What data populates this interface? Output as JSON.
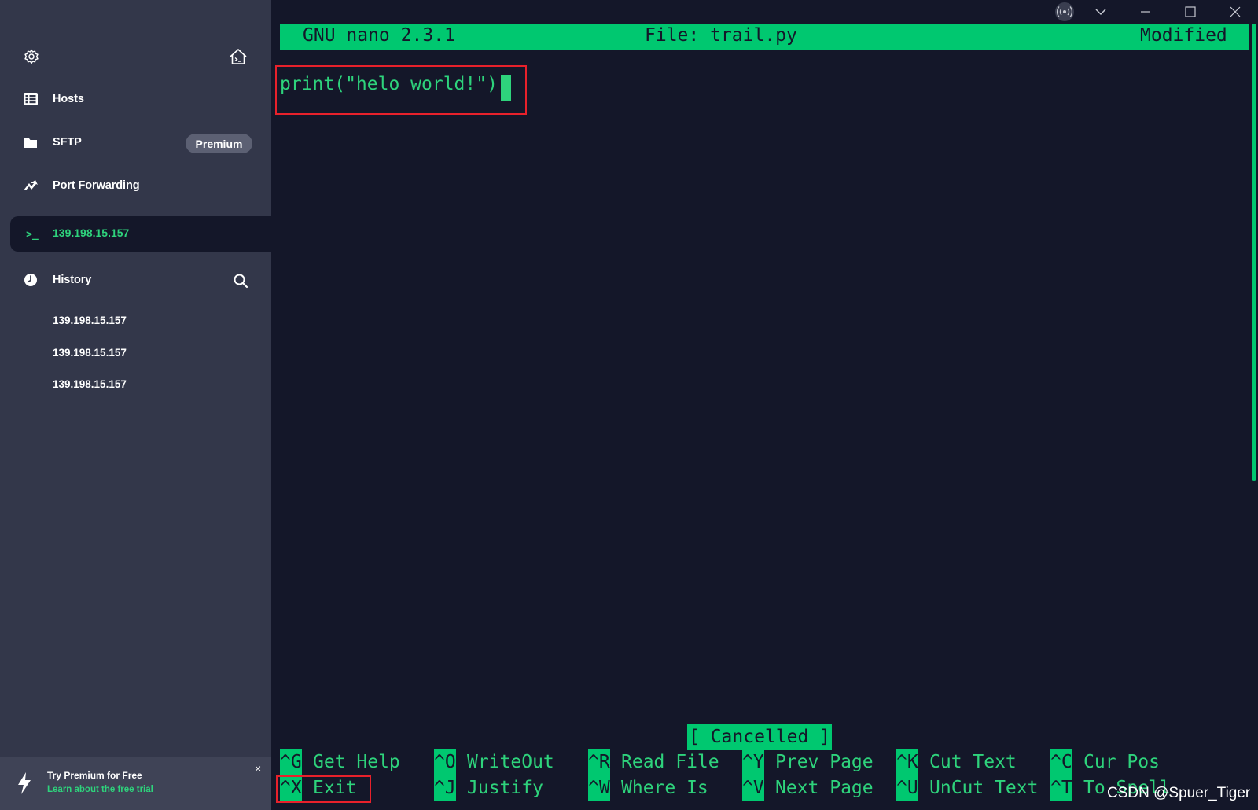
{
  "colors": {
    "sidebar_bg": "#33374a",
    "terminal_bg": "#141729",
    "accent_green": "#2ed37c",
    "highlight_green": "#00c870",
    "badge_bg": "#5c6073",
    "annotation_red": "#e8212b"
  },
  "sidebar": {
    "top_icons": [
      "gear-icon",
      "home-terminal-icon"
    ],
    "nav": [
      {
        "label": "Hosts",
        "icon": "hosts-grid-icon"
      },
      {
        "label": "SFTP",
        "icon": "folder-icon",
        "badge": "Premium"
      },
      {
        "label": "Port Forwarding",
        "icon": "port-forward-icon"
      }
    ],
    "active_session": {
      "label": "139.198.15.157",
      "icon": "terminal-prompt-icon",
      "icon_text": ">_"
    },
    "history": {
      "label": "History",
      "icon": "clock-icon",
      "search_icon": "search-icon",
      "items": [
        "139.198.15.157",
        "139.198.15.157",
        "139.198.15.157"
      ]
    },
    "promo": {
      "title": "Try Premium for Free",
      "link": "Learn about the free trial",
      "close": "×",
      "icon": "lightning-icon"
    }
  },
  "window_controls": [
    "broadcast-icon",
    "chevron-down-icon",
    "minimize-icon",
    "maximize-icon",
    "close-icon"
  ],
  "terminal": {
    "titlebar": {
      "left": "GNU nano 2.3.1",
      "center": "File: trail.py",
      "right": "Modified"
    },
    "content_line": "print(\"helo world!\")",
    "status_message": "[ Cancelled ]",
    "shortcuts_row1": [
      {
        "key": "^G",
        "label": "Get Help"
      },
      {
        "key": "^O",
        "label": "WriteOut"
      },
      {
        "key": "^R",
        "label": "Read File"
      },
      {
        "key": "^Y",
        "label": "Prev Page"
      },
      {
        "key": "^K",
        "label": "Cut Text"
      },
      {
        "key": "^C",
        "label": "Cur Pos"
      }
    ],
    "shortcuts_row2": [
      {
        "key": "^X",
        "label": "Exit"
      },
      {
        "key": "^J",
        "label": "Justify"
      },
      {
        "key": "^W",
        "label": "Where Is"
      },
      {
        "key": "^V",
        "label": "Next Page"
      },
      {
        "key": "^U",
        "label": "UnCut Text"
      },
      {
        "key": "^T",
        "label": "To Spell"
      }
    ]
  },
  "watermark": "CSDN @Spuer_Tiger"
}
